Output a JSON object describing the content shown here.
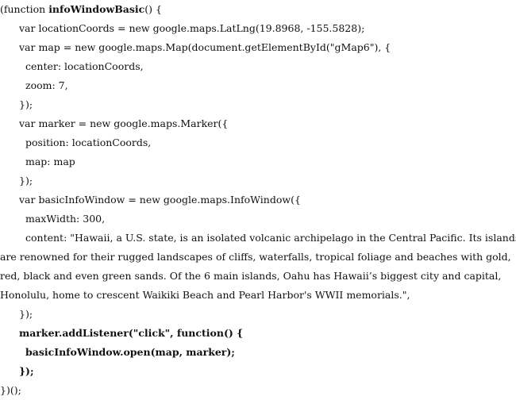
{
  "code": {
    "l1_pre": "(function ",
    "l1_fn": "infoWindowBasic",
    "l1_post": "() {",
    "l2": "var locationCoords = new google.maps.LatLng(19.8968, -155.5828);",
    "l3": "var map = new google.maps.Map(document.getElementById(\"gMap6\"), {",
    "l4": "center: locationCoords,",
    "l5": "zoom: 7,",
    "l6": "});",
    "l7": "var marker = new google.maps.Marker({",
    "l8": "position: locationCoords,",
    "l9": "map: map",
    "l10": "});",
    "l11": "var basicInfoWindow = new google.maps.InfoWindow({",
    "l12": "maxWidth: 300,",
    "l13": "content: \"Hawaii, a U.S. state, is an isolated volcanic archipelago in the Central Pacific. Its islands",
    "l14": "are renowned for their rugged landscapes of cliffs, waterfalls, tropical foliage and beaches with gold,",
    "l15": "red, black and even green sands. Of the 6 main islands, Oahu has Hawaii’s biggest city and capital,",
    "l16": "Honolulu, home to crescent Waikiki Beach and Pearl Harbor's WWII memorials.\",",
    "l17": "});",
    "l18": "marker.addListener(\"click\", function() {",
    "l19": "basicInfoWindow.open(map, marker);",
    "l20": "});",
    "l21": "})();"
  }
}
